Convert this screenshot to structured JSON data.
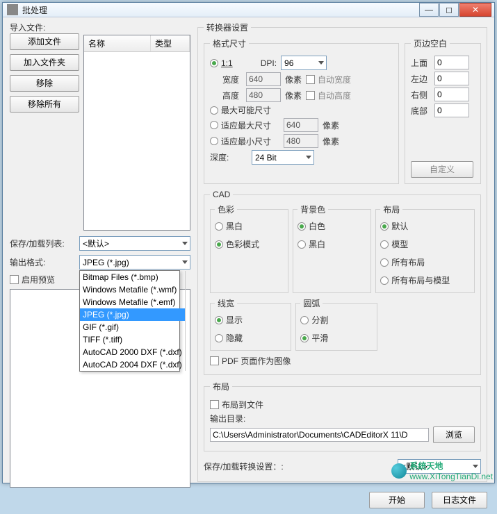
{
  "window": {
    "title": "批处理"
  },
  "left": {
    "import_label": "导入文件:",
    "btn_add_file": "添加文件",
    "btn_add_folder": "加入文件夹",
    "btn_remove": "移除",
    "btn_remove_all": "移除所有",
    "list_cols": {
      "name": "名称",
      "type": "类型"
    },
    "saveload_label": "保存/加载列表:",
    "saveload_value": "<默认>",
    "output_format_label": "输出格式:",
    "output_format_value": "JPEG (*.jpg)",
    "format_options": [
      "Bitmap Files (*.bmp)",
      "Windows Metafile (*.wmf)",
      "Windows Metafile (*.emf)",
      "JPEG (*.jpg)",
      "GIF (*.gif)",
      "TIFF (*.tiff)",
      "AutoCAD 2000 DXF (*.dxf)",
      "AutoCAD 2004 DXF (*.dxf)"
    ],
    "enable_preview": "启用预览"
  },
  "converter": {
    "legend": "转换器设置",
    "format_size": {
      "legend": "格式尺寸",
      "one_to_one": "1:1",
      "dpi_label": "DPI:",
      "dpi_value": "96",
      "width_label": "宽度",
      "width_value": "640",
      "width_unit": "像素",
      "auto_width": "自动宽度",
      "height_label": "高度",
      "height_value": "480",
      "height_unit": "像素",
      "auto_height": "自动高度",
      "max_possible": "最大可能尺寸",
      "fit_max": "适应最大尺寸",
      "fit_max_value": "640",
      "fit_max_unit": "像素",
      "fit_min": "适应最小尺寸",
      "fit_min_value": "480",
      "fit_min_unit": "像素",
      "depth_label": "深度:",
      "depth_value": "24 Bit",
      "custom_btn": "自定义"
    },
    "margins": {
      "legend": "页边空白",
      "top": "上面",
      "top_v": "0",
      "left": "左边",
      "left_v": "0",
      "right": "右侧",
      "right_v": "0",
      "bottom": "底部",
      "bottom_v": "0"
    },
    "cad": {
      "legend": "CAD",
      "color": {
        "legend": "色彩",
        "bw": "黑白",
        "color_mode": "色彩模式"
      },
      "bg": {
        "legend": "背景色",
        "white": "白色",
        "black": "黑白"
      },
      "layout": {
        "legend": "布局",
        "default": "默认",
        "model": "模型",
        "all": "所有布局",
        "all_model": "所有布局与模型"
      },
      "lw": {
        "legend": "线宽",
        "show": "显示",
        "hide": "隐藏"
      },
      "arc": {
        "legend": "圆弧",
        "split": "分割",
        "smooth": "平滑"
      },
      "pdf_as_image": "PDF 页面作为图像"
    },
    "layout_out": {
      "legend": "布局",
      "to_file": "布局到文件",
      "dir_label": "输出目录:",
      "dir_value": "C:\\Users\\Administrator\\Documents\\CADEditorX 11\\D",
      "browse": "浏览"
    },
    "saveload_conv": "保存/加载转换设置：:",
    "saveload_conv_value": "<默认>"
  },
  "footer": {
    "start": "开始",
    "log": "日志文件",
    "brand1": "系统天地",
    "brand2": "www.XiTongTianDi.net"
  }
}
